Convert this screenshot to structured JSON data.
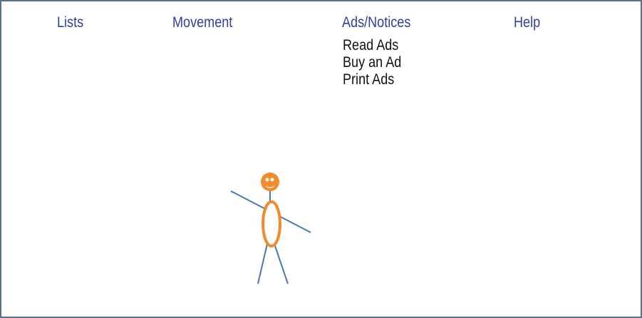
{
  "menu": {
    "lists_label": "Lists",
    "movement_label": "Movement",
    "ads_label": "Ads/Notices",
    "help_label": "Help"
  },
  "dropdown": {
    "items": [
      {
        "label": "Read Ads"
      },
      {
        "label": "Buy an Ad"
      },
      {
        "label": "Print Ads"
      }
    ]
  },
  "figure": {
    "icon": "stick-figure-icon",
    "head_color": "#f28c2b",
    "limb_color": "#4a78b5"
  },
  "colors": {
    "menu_text": "#2f3fa0",
    "dropdown_text": "#111111",
    "border": "#5b6f88"
  }
}
